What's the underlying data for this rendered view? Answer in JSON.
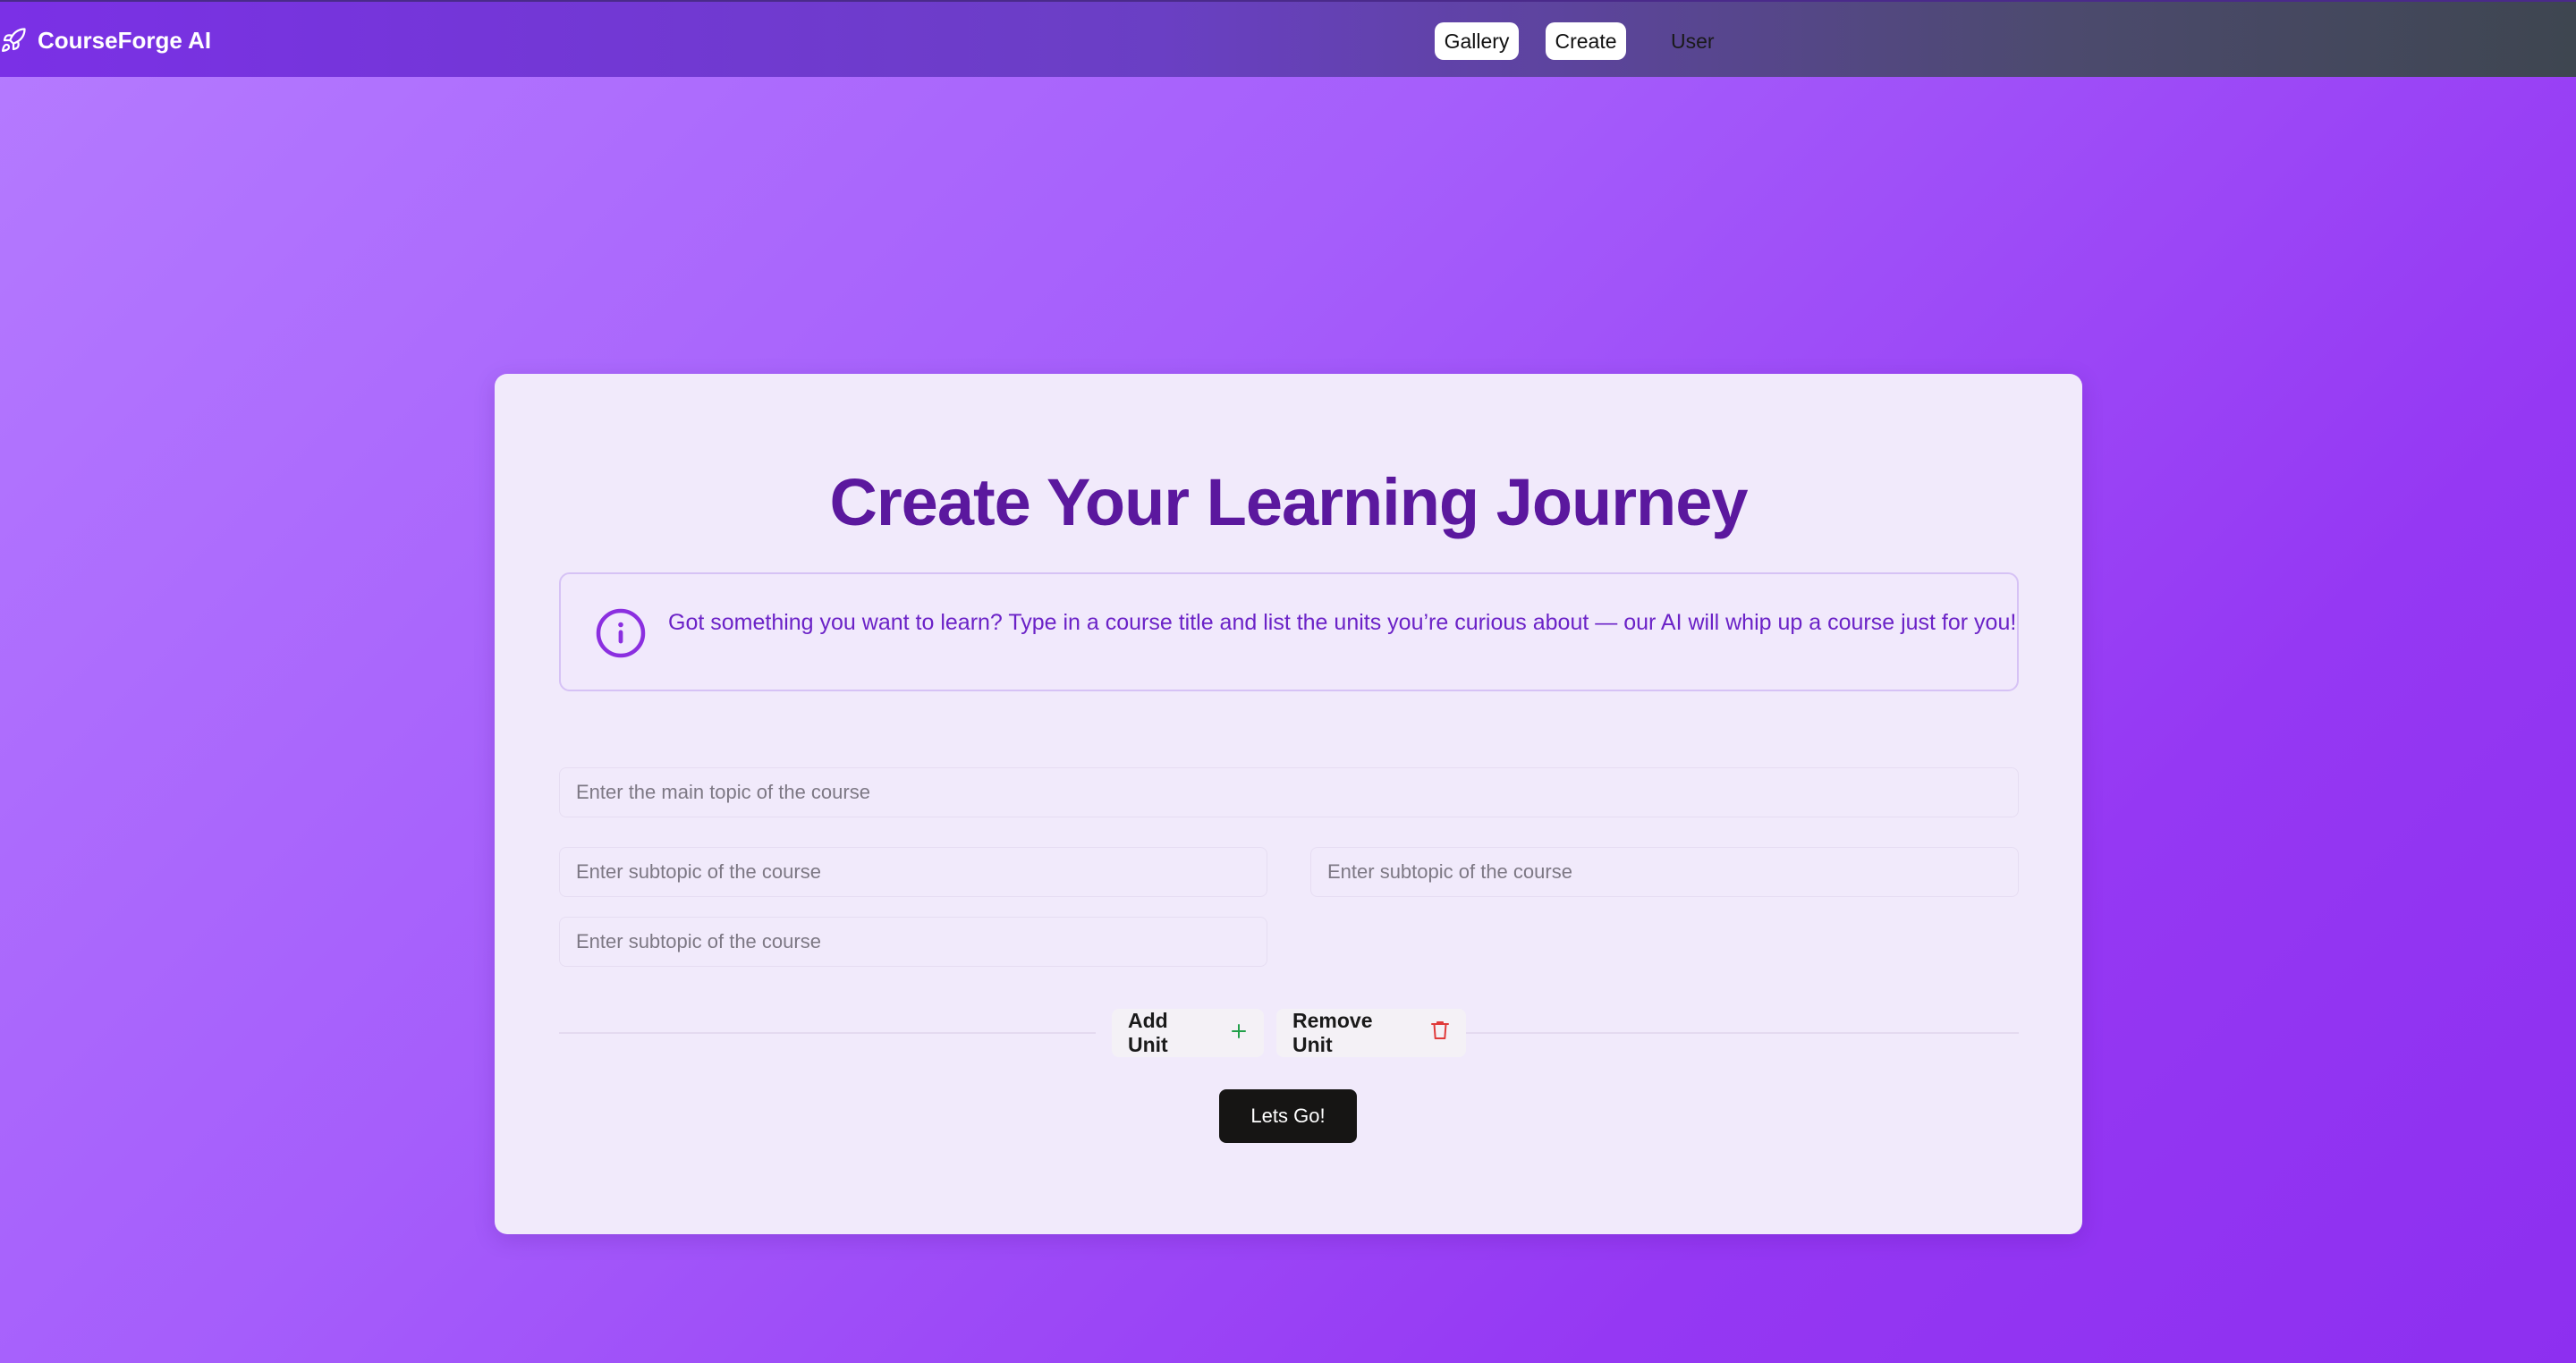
{
  "app": {
    "brand": "CourseForge AI"
  },
  "nav": {
    "gallery": "Gallery",
    "create": "Create",
    "user": "User"
  },
  "main": {
    "title": "Create Your Learning Journey",
    "info_text": "Got something you want to learn? Type in a course title and list the units you’re curious about — our AI will whip up a course just for you!",
    "topic_placeholder": "Enter the main topic of the course",
    "subtopic_placeholders": [
      "Enter subtopic of the course",
      "Enter subtopic of the course",
      "Enter subtopic of the course"
    ],
    "add_unit_label": "Add Unit",
    "remove_unit_label": "Remove Unit",
    "submit_label": "Lets Go!"
  },
  "icons": {
    "brand": "rocket-icon",
    "info": "info-icon",
    "add": "plus-icon",
    "remove": "trash-icon"
  },
  "colors": {
    "accent": "#5b189e",
    "info_text": "#6b22c7",
    "add_icon": "#22a04a",
    "remove_icon": "#e03a3a",
    "primary_button": "#161514"
  }
}
